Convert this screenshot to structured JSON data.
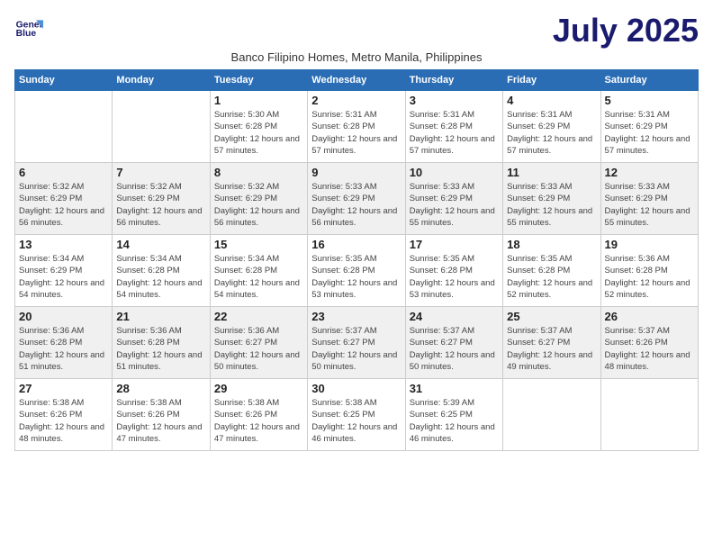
{
  "logo": {
    "line1": "General",
    "line2": "Blue"
  },
  "title": "July 2025",
  "subtitle": "Banco Filipino Homes, Metro Manila, Philippines",
  "days_of_week": [
    "Sunday",
    "Monday",
    "Tuesday",
    "Wednesday",
    "Thursday",
    "Friday",
    "Saturday"
  ],
  "weeks": [
    [
      {
        "day": null
      },
      {
        "day": null
      },
      {
        "day": "1",
        "sunrise": "5:30 AM",
        "sunset": "6:28 PM",
        "daylight": "12 hours and 57 minutes."
      },
      {
        "day": "2",
        "sunrise": "5:31 AM",
        "sunset": "6:28 PM",
        "daylight": "12 hours and 57 minutes."
      },
      {
        "day": "3",
        "sunrise": "5:31 AM",
        "sunset": "6:28 PM",
        "daylight": "12 hours and 57 minutes."
      },
      {
        "day": "4",
        "sunrise": "5:31 AM",
        "sunset": "6:29 PM",
        "daylight": "12 hours and 57 minutes."
      },
      {
        "day": "5",
        "sunrise": "5:31 AM",
        "sunset": "6:29 PM",
        "daylight": "12 hours and 57 minutes."
      }
    ],
    [
      {
        "day": "6",
        "sunrise": "5:32 AM",
        "sunset": "6:29 PM",
        "daylight": "12 hours and 56 minutes."
      },
      {
        "day": "7",
        "sunrise": "5:32 AM",
        "sunset": "6:29 PM",
        "daylight": "12 hours and 56 minutes."
      },
      {
        "day": "8",
        "sunrise": "5:32 AM",
        "sunset": "6:29 PM",
        "daylight": "12 hours and 56 minutes."
      },
      {
        "day": "9",
        "sunrise": "5:33 AM",
        "sunset": "6:29 PM",
        "daylight": "12 hours and 56 minutes."
      },
      {
        "day": "10",
        "sunrise": "5:33 AM",
        "sunset": "6:29 PM",
        "daylight": "12 hours and 55 minutes."
      },
      {
        "day": "11",
        "sunrise": "5:33 AM",
        "sunset": "6:29 PM",
        "daylight": "12 hours and 55 minutes."
      },
      {
        "day": "12",
        "sunrise": "5:33 AM",
        "sunset": "6:29 PM",
        "daylight": "12 hours and 55 minutes."
      }
    ],
    [
      {
        "day": "13",
        "sunrise": "5:34 AM",
        "sunset": "6:29 PM",
        "daylight": "12 hours and 54 minutes."
      },
      {
        "day": "14",
        "sunrise": "5:34 AM",
        "sunset": "6:28 PM",
        "daylight": "12 hours and 54 minutes."
      },
      {
        "day": "15",
        "sunrise": "5:34 AM",
        "sunset": "6:28 PM",
        "daylight": "12 hours and 54 minutes."
      },
      {
        "day": "16",
        "sunrise": "5:35 AM",
        "sunset": "6:28 PM",
        "daylight": "12 hours and 53 minutes."
      },
      {
        "day": "17",
        "sunrise": "5:35 AM",
        "sunset": "6:28 PM",
        "daylight": "12 hours and 53 minutes."
      },
      {
        "day": "18",
        "sunrise": "5:35 AM",
        "sunset": "6:28 PM",
        "daylight": "12 hours and 52 minutes."
      },
      {
        "day": "19",
        "sunrise": "5:36 AM",
        "sunset": "6:28 PM",
        "daylight": "12 hours and 52 minutes."
      }
    ],
    [
      {
        "day": "20",
        "sunrise": "5:36 AM",
        "sunset": "6:28 PM",
        "daylight": "12 hours and 51 minutes."
      },
      {
        "day": "21",
        "sunrise": "5:36 AM",
        "sunset": "6:28 PM",
        "daylight": "12 hours and 51 minutes."
      },
      {
        "day": "22",
        "sunrise": "5:36 AM",
        "sunset": "6:27 PM",
        "daylight": "12 hours and 50 minutes."
      },
      {
        "day": "23",
        "sunrise": "5:37 AM",
        "sunset": "6:27 PM",
        "daylight": "12 hours and 50 minutes."
      },
      {
        "day": "24",
        "sunrise": "5:37 AM",
        "sunset": "6:27 PM",
        "daylight": "12 hours and 50 minutes."
      },
      {
        "day": "25",
        "sunrise": "5:37 AM",
        "sunset": "6:27 PM",
        "daylight": "12 hours and 49 minutes."
      },
      {
        "day": "26",
        "sunrise": "5:37 AM",
        "sunset": "6:26 PM",
        "daylight": "12 hours and 48 minutes."
      }
    ],
    [
      {
        "day": "27",
        "sunrise": "5:38 AM",
        "sunset": "6:26 PM",
        "daylight": "12 hours and 48 minutes."
      },
      {
        "day": "28",
        "sunrise": "5:38 AM",
        "sunset": "6:26 PM",
        "daylight": "12 hours and 47 minutes."
      },
      {
        "day": "29",
        "sunrise": "5:38 AM",
        "sunset": "6:26 PM",
        "daylight": "12 hours and 47 minutes."
      },
      {
        "day": "30",
        "sunrise": "5:38 AM",
        "sunset": "6:25 PM",
        "daylight": "12 hours and 46 minutes."
      },
      {
        "day": "31",
        "sunrise": "5:39 AM",
        "sunset": "6:25 PM",
        "daylight": "12 hours and 46 minutes."
      },
      {
        "day": null
      },
      {
        "day": null
      }
    ]
  ]
}
